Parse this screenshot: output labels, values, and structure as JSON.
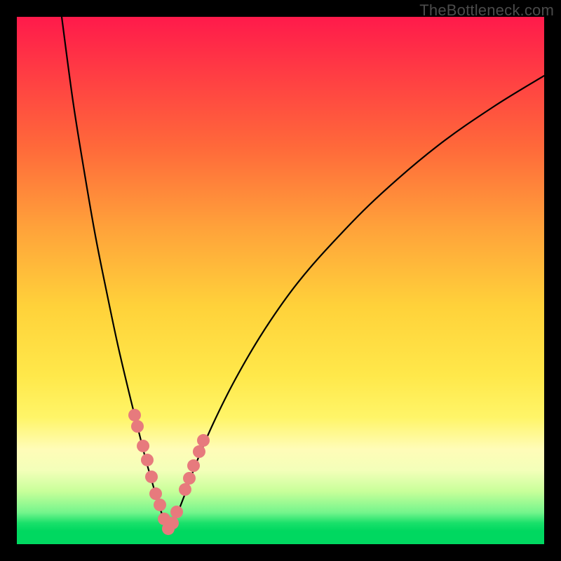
{
  "watermark": "TheBottleneck.com",
  "colors": {
    "frame_bg": "#000000",
    "curve": "#000000",
    "marker": "#e77a7d",
    "gradient_top": "#ff1a4b",
    "gradient_bottom": "#00d860"
  },
  "chart_data": {
    "type": "line",
    "title": "",
    "xlabel": "",
    "ylabel": "",
    "xlim": [
      0,
      100
    ],
    "ylim": [
      0,
      100
    ],
    "note": "Axes unlabeled; values are positions in percent of plot area (0,0 = top-left).",
    "series": [
      {
        "name": "left-branch",
        "x": [
          8.51,
          10.64,
          12.77,
          14.89,
          17.02,
          19.15,
          21.28,
          22.34,
          23.4,
          24.47,
          25.53,
          26.6,
          27.66,
          28.72
        ],
        "y": [
          0.0,
          15.96,
          29.26,
          41.49,
          52.13,
          62.23,
          71.28,
          75.53,
          79.79,
          84.04,
          87.77,
          91.49,
          94.68,
          97.34
        ]
      },
      {
        "name": "right-branch",
        "x": [
          28.72,
          29.79,
          31.91,
          34.04,
          37.23,
          41.49,
          46.81,
          53.19,
          60.64,
          69.15,
          79.79,
          90.43,
          100.0
        ],
        "y": [
          97.34,
          95.74,
          90.43,
          84.57,
          77.13,
          68.62,
          59.57,
          50.53,
          42.02,
          33.51,
          24.47,
          17.02,
          11.17
        ]
      }
    ],
    "markers": {
      "name": "highlighted-points",
      "x": [
        22.34,
        22.87,
        23.94,
        24.73,
        25.53,
        26.33,
        27.13,
        27.93,
        28.72,
        29.52,
        30.32,
        31.91,
        32.71,
        33.51,
        34.57,
        35.37
      ],
      "y": [
        75.53,
        77.66,
        81.38,
        84.04,
        87.23,
        90.43,
        92.55,
        95.21,
        97.07,
        96.01,
        93.88,
        89.63,
        87.5,
        85.11,
        82.45,
        80.32
      ]
    }
  }
}
